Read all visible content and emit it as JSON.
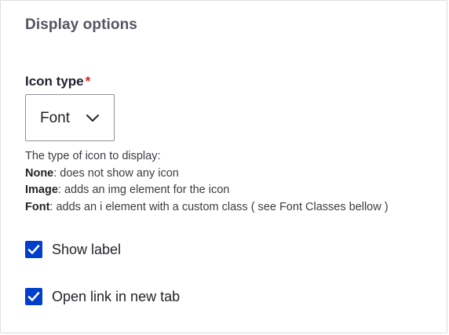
{
  "section": {
    "title": "Display options"
  },
  "icon_type": {
    "label": "Icon type",
    "required_mark": "*",
    "selected_value": "Font",
    "help": {
      "intro": "The type of icon to display:",
      "options": [
        {
          "term": "None",
          "desc": ": does not show any icon"
        },
        {
          "term": "Image",
          "desc": ": adds an img element for the icon"
        },
        {
          "term": "Font",
          "desc": ": adds an i element with a custom class ( see Font Classes bellow )"
        }
      ]
    }
  },
  "checkboxes": [
    {
      "label": "Show label",
      "checked": true
    },
    {
      "label": "Open link in new tab",
      "checked": true
    }
  ],
  "colors": {
    "checkbox_fill": "#003ecc",
    "required": "#d72222",
    "title": "#545560"
  },
  "icons": {
    "select_chevron": "chevron-down-icon",
    "checkbox_mark": "checkmark-icon"
  }
}
